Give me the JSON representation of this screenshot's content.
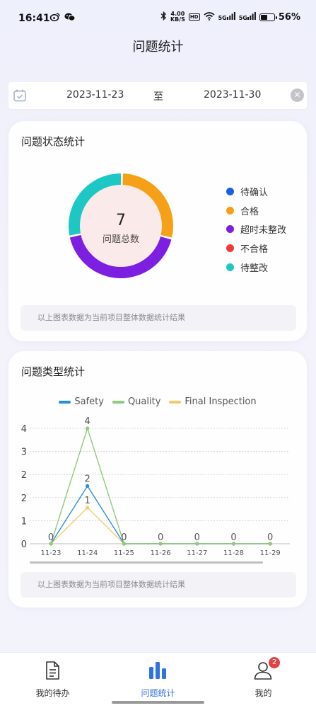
{
  "status_bar": {
    "time": "16:41",
    "net_speed_value": "4.00",
    "net_speed_unit": "KB/S",
    "hd_label": "HD",
    "signal1_label": "5G",
    "signal2_label": "5G",
    "battery_percent": 56,
    "battery_text": "56%",
    "icons": [
      "weibo-icon",
      "wechat-icon",
      "bluetooth-icon",
      "wifi-icon",
      "signal-icon",
      "battery-icon"
    ]
  },
  "header": {
    "title": "问题统计"
  },
  "date_range": {
    "start": "2023-11-23",
    "separator": "至",
    "end": "2023-11-30",
    "clear_glyph": "✕"
  },
  "status_card": {
    "title": "问题状态统计",
    "center_value": "7",
    "center_label": "问题总数",
    "note": "以上图表数据为当前项目整体数据统计结果",
    "legend": [
      {
        "label": "待确认",
        "color": "#1e5fe0"
      },
      {
        "label": "合格",
        "color": "#f5a016"
      },
      {
        "label": "超时未整改",
        "color": "#7d1fe0"
      },
      {
        "label": "不合格",
        "color": "#f03a3a"
      },
      {
        "label": "待整改",
        "color": "#1cc7c4"
      }
    ]
  },
  "type_card": {
    "title": "问题类型统计",
    "note": "以上图表数据为当前项目整体数据统计结果"
  },
  "chart_data": [
    {
      "type": "pie",
      "categories": [
        "待确认",
        "合格",
        "超时未整改",
        "不合格",
        "待整改"
      ],
      "values": [
        0,
        2,
        3,
        0,
        2
      ],
      "colors": [
        "#1e5fe0",
        "#f5a016",
        "#7d1fe0",
        "#f03a3a",
        "#1cc7c4"
      ],
      "title": "",
      "legend": "right"
    },
    {
      "type": "line",
      "x": [
        "11-23",
        "11-24",
        "11-25",
        "11-26",
        "11-27",
        "11-28",
        "11-29"
      ],
      "series": [
        {
          "name": "Safety",
          "values": [
            0,
            2,
            0,
            0,
            0,
            0,
            0
          ],
          "color": "#2a8ee0"
        },
        {
          "name": "Quality",
          "values": [
            0,
            4,
            0,
            0,
            0,
            0,
            0
          ],
          "color": "#92c97a"
        },
        {
          "name": "Final Inspection",
          "values": [
            0,
            1.25,
            0,
            0,
            0,
            0,
            0
          ],
          "color": "#f2cc6a"
        }
      ],
      "data_labels": [
        "0",
        "4",
        "0",
        "0",
        "0",
        "0",
        "0"
      ],
      "peak_labels": {
        "Quality": "4",
        "Safety": "2",
        "Final Inspection": "1"
      },
      "yticks": [
        "0",
        "1",
        "2",
        "2",
        "3",
        "4"
      ],
      "ylim": [
        0,
        4
      ],
      "grid": true,
      "legend": "top",
      "title": "",
      "xlabel": "",
      "ylabel": ""
    }
  ],
  "tabbar": {
    "tabs": [
      {
        "label": "我的待办",
        "icon": "document-icon",
        "active": false
      },
      {
        "label": "问题统计",
        "icon": "bar-chart-icon",
        "active": true
      },
      {
        "label": "我的",
        "icon": "user-icon",
        "active": false,
        "badge": "2"
      }
    ]
  }
}
